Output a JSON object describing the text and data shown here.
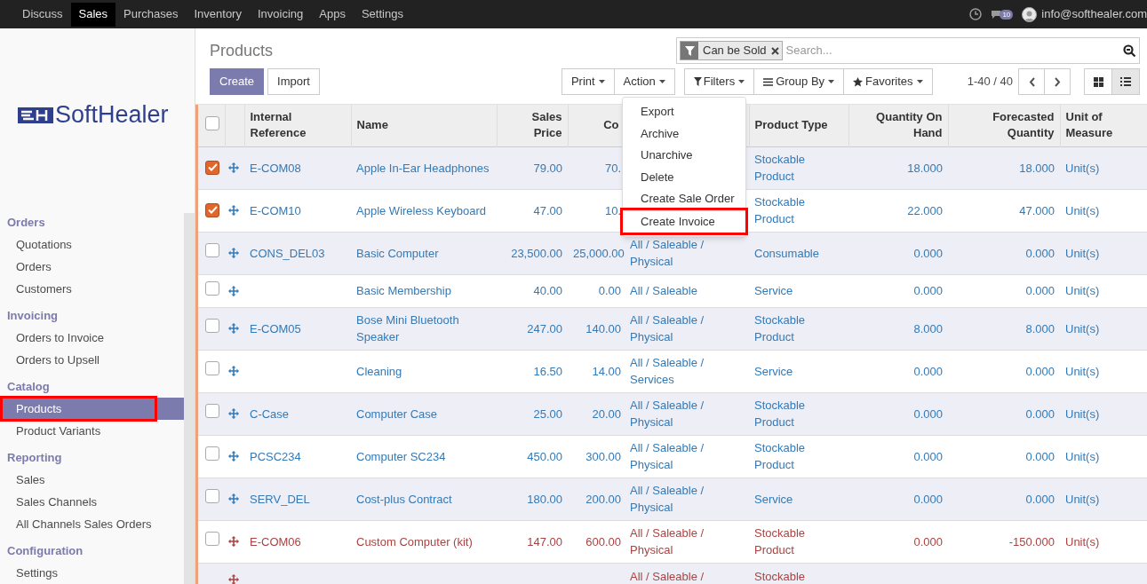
{
  "top_menu": [
    {
      "label": "Discuss",
      "selected": false
    },
    {
      "label": "Sales",
      "selected": true
    },
    {
      "label": "Purchases",
      "selected": false
    },
    {
      "label": "Inventory",
      "selected": false
    },
    {
      "label": "Invoicing",
      "selected": false
    },
    {
      "label": "Apps",
      "selected": false
    },
    {
      "label": "Settings",
      "selected": false
    }
  ],
  "user": {
    "message_count": "10",
    "email": "info@softhealer.com"
  },
  "logo": {
    "text": "SoftHealer"
  },
  "sidebar": [
    {
      "title": "Orders",
      "items": [
        {
          "label": "Quotations",
          "selected": false,
          "highlighted": false
        },
        {
          "label": "Orders",
          "selected": false,
          "highlighted": false
        },
        {
          "label": "Customers",
          "selected": false,
          "highlighted": false
        }
      ]
    },
    {
      "title": "Invoicing",
      "items": [
        {
          "label": "Orders to Invoice",
          "selected": false,
          "highlighted": false
        },
        {
          "label": "Orders to Upsell",
          "selected": false,
          "highlighted": false
        }
      ]
    },
    {
      "title": "Catalog",
      "items": [
        {
          "label": "Products",
          "selected": true,
          "highlighted": true
        },
        {
          "label": "Product Variants",
          "selected": false,
          "highlighted": false
        }
      ]
    },
    {
      "title": "Reporting",
      "items": [
        {
          "label": "Sales",
          "selected": false,
          "highlighted": false
        },
        {
          "label": "Sales Channels",
          "selected": false,
          "highlighted": false
        },
        {
          "label": "All Channels Sales Orders",
          "selected": false,
          "highlighted": false
        }
      ]
    },
    {
      "title": "Configuration",
      "items": [
        {
          "label": "Settings",
          "selected": false,
          "highlighted": false
        }
      ]
    }
  ],
  "page_title": "Products",
  "buttons": {
    "create": "Create",
    "import": "Import",
    "print": "Print",
    "action": "Action",
    "filters": "Filters",
    "group_by": "Group By",
    "favorites": "Favorites"
  },
  "search": {
    "facet": "Can be Sold",
    "placeholder": "Search..."
  },
  "pager": "1-40 / 40",
  "views": [
    {
      "kind": "kanban",
      "selected": false
    },
    {
      "kind": "list",
      "selected": true
    }
  ],
  "action_menu": [
    {
      "label": "Export",
      "highlighted": false
    },
    {
      "label": "Archive",
      "highlighted": false
    },
    {
      "label": "Unarchive",
      "highlighted": false
    },
    {
      "label": "Delete",
      "highlighted": false
    },
    {
      "label": "Create Sale Order",
      "highlighted": false
    },
    {
      "label": "Create Invoice",
      "highlighted": true
    }
  ],
  "table": {
    "columns": [
      "Internal Reference",
      "Name",
      "Sales Price",
      "Co",
      null,
      "Product Type",
      "Quantity On Hand",
      "Forecasted Quantity",
      "Unit of Measure"
    ],
    "header_checked": false,
    "rows": [
      {
        "checked": true,
        "warning": false,
        "cells": [
          "E-COM08",
          "Apple In-Ear Headphones",
          "79.00",
          "70.",
          null,
          "Stockable Product",
          "18.000",
          "18.000",
          "Unit(s)"
        ]
      },
      {
        "checked": true,
        "warning": false,
        "cells": [
          "E-COM10",
          "Apple Wireless Keyboard",
          "47.00",
          "10.",
          null,
          "Stockable Product",
          "22.000",
          "47.000",
          "Unit(s)"
        ]
      },
      {
        "checked": false,
        "warning": false,
        "cells": [
          "CONS_DEL03",
          "Basic Computer",
          "23,500.00",
          "25,000.00",
          "All / Saleable / Physical",
          "Consumable",
          "0.000",
          "0.000",
          "Unit(s)"
        ]
      },
      {
        "checked": false,
        "warning": false,
        "cells": [
          null,
          "Basic Membership",
          "40.00",
          "0.00",
          "All / Saleable",
          "Service",
          "0.000",
          "0.000",
          "Unit(s)"
        ]
      },
      {
        "checked": false,
        "warning": false,
        "cells": [
          "E-COM05",
          "Bose Mini Bluetooth Speaker",
          "247.00",
          "140.00",
          "All / Saleable / Physical",
          "Stockable Product",
          "8.000",
          "8.000",
          "Unit(s)"
        ]
      },
      {
        "checked": false,
        "warning": false,
        "cells": [
          null,
          "Cleaning",
          "16.50",
          "14.00",
          "All / Saleable / Services",
          "Service",
          "0.000",
          "0.000",
          "Unit(s)"
        ]
      },
      {
        "checked": false,
        "warning": false,
        "cells": [
          "C-Case",
          "Computer Case",
          "25.00",
          "20.00",
          "All / Saleable / Physical",
          "Stockable Product",
          "0.000",
          "0.000",
          "Unit(s)"
        ]
      },
      {
        "checked": false,
        "warning": false,
        "cells": [
          "PCSC234",
          "Computer SC234",
          "450.00",
          "300.00",
          "All / Saleable / Physical",
          "Stockable Product",
          "0.000",
          "0.000",
          "Unit(s)"
        ]
      },
      {
        "checked": false,
        "warning": false,
        "cells": [
          "SERV_DEL",
          "Cost-plus Contract",
          "180.00",
          "200.00",
          "All / Saleable / Physical",
          "Service",
          "0.000",
          "0.000",
          "Unit(s)"
        ]
      },
      {
        "checked": false,
        "warning": true,
        "cells": [
          "E-COM06",
          "Custom Computer (kit)",
          "147.00",
          "600.00",
          "All / Saleable / Physical",
          "Stockable Product",
          "0.000",
          "-150.000",
          "Unit(s)"
        ]
      },
      {
        "warning": true,
        "cells": [
          null,
          null,
          null,
          null,
          "All / Saleable /",
          "Stockable",
          null,
          null,
          null
        ]
      }
    ]
  }
}
